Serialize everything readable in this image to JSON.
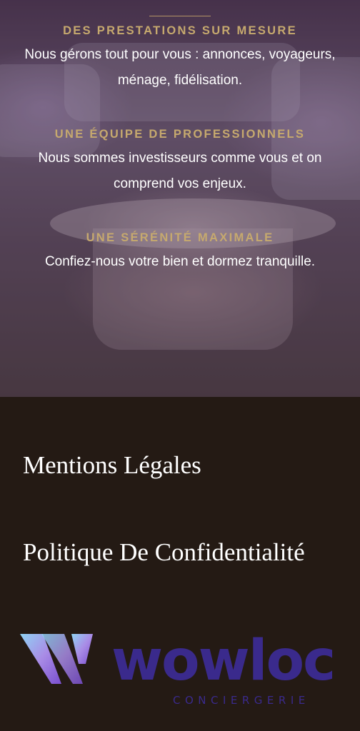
{
  "features": [
    {
      "title": "DES PRESTATIONS SUR MESURE",
      "text": "Nous gérons tout pour vous : annonces, voyageurs, ménage, fidélisation."
    },
    {
      "title": "UNE ÉQUIPE DE PROFESSIONNELS",
      "text": "Nous sommes investisseurs comme vous et on comprend vos enjeux."
    },
    {
      "title": "UNE SÉRÉNITÉ MAXIMALE",
      "text": "Confiez-nous votre bien et dormez tranquille."
    }
  ],
  "footer": {
    "mentions": "Mentions Légales",
    "privacy": "Politique De Confidentialité"
  },
  "logo": {
    "name": "wowloc",
    "tagline": "CONCIERGERIE"
  },
  "colors": {
    "accent_gold": "#c6a96e",
    "footer_bg": "#241a14",
    "logo_purple": "#3a2a8c"
  }
}
